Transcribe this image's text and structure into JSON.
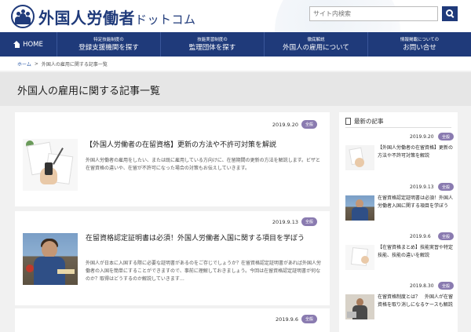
{
  "header": {
    "logo_text": "外国人労働者",
    "logo_suffix": "ドットコム",
    "search_placeholder": "サイト内検索"
  },
  "nav": {
    "home": "HOME",
    "items": [
      {
        "small": "特定技能制度の",
        "big": "登録支援機関を探す"
      },
      {
        "small": "技能実習制度の",
        "big": "監理団体を探す"
      },
      {
        "small": "徹底解説",
        "big": "外国人の雇用について"
      },
      {
        "small": "情報掲載についての",
        "big": "お問い合せ"
      }
    ]
  },
  "breadcrumb": {
    "home": "ホーム",
    "separator": ">",
    "current": "外国人の雇用に関する記事一覧"
  },
  "page_title": "外国人の雇用に関する記事一覧",
  "articles": [
    {
      "date": "2019.9.20",
      "badge": "全般",
      "title": "【外国人労働者の在留資格】更新の方法や不許可対策を解説",
      "desc": "外国人労働者の雇用をしたい、または既に雇用している方向けに、在留期間の更新の方法を解説します。ビザと在留資格の違いや、在留が不許可になった場合の対策もお伝えしていきます。"
    },
    {
      "date": "2019.9.13",
      "badge": "全般",
      "title": "在留資格認定証明書は必須！外国人労働者入国に関する項目を学ぼう",
      "desc": "外国人が日本に入国する際に必要な証明書があるのをご存じでしょうか？在留資格認定証明書があれば外国人労働者の入国を簡単にすることができますので、事前に理解しておきましょう。今回は在留資格認定証明書が何なのか？取得はどうするのか解説していきます…"
    },
    {
      "date": "2019.9.6",
      "badge": "全般",
      "title": "",
      "desc": ""
    }
  ],
  "sidebar": {
    "heading": "最新の記事",
    "items": [
      {
        "date": "2019.9.20",
        "badge": "全般",
        "title": "【外国人労働者の在留資格】更新の方法や不許可対策を解説"
      },
      {
        "date": "2019.9.13",
        "badge": "全般",
        "title": "在留資格認定証明書は必須！外国人労働者入国に関する項目を学ぼう"
      },
      {
        "date": "2019.9.6",
        "badge": "全般",
        "title": "【在留資格まとめ】技能実習や特定技能、技能の違いを解説"
      },
      {
        "date": "2019.8.30",
        "badge": "全般",
        "title": "在留資格制度とは？　外国人が在留資格を取り消しになるケースも解説"
      }
    ]
  },
  "colors": {
    "brand_navy": "#1f3a7a",
    "badge_purple": "#8a7bb0",
    "link_blue": "#2b5aa8"
  },
  "icons": [
    "logo-people-icon",
    "search-icon",
    "home-icon",
    "document-icon"
  ]
}
